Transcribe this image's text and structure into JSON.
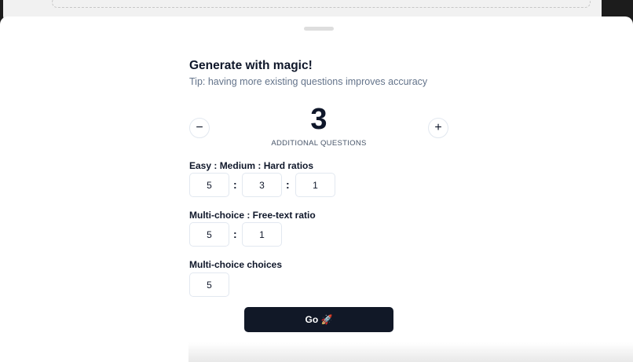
{
  "dialog": {
    "title": "Generate with magic!",
    "tip": "Tip: having more existing questions improves accuracy"
  },
  "counter": {
    "value": "3",
    "label": "ADDITIONAL QUESTIONS",
    "minus_symbol": "−",
    "plus_symbol": "+"
  },
  "difficulty": {
    "label": "Easy : Medium : Hard ratios",
    "easy": "5",
    "medium": "3",
    "hard": "1"
  },
  "type_ratio": {
    "label": "Multi-choice : Free-text ratio",
    "multi_choice": "5",
    "free_text": "1"
  },
  "choices": {
    "label": "Multi-choice choices",
    "value": "5"
  },
  "separator": ":",
  "go_button": {
    "label": "Go 🚀"
  }
}
